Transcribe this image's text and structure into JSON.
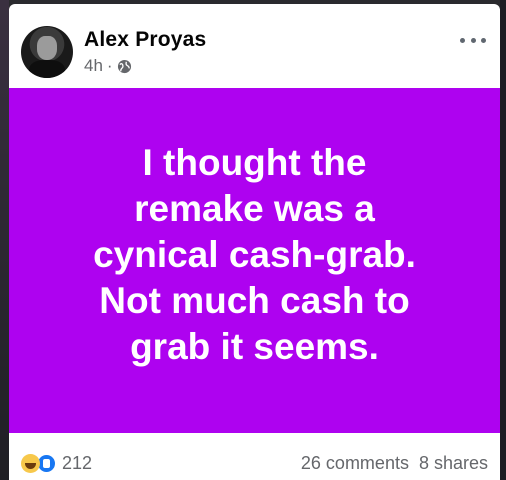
{
  "post": {
    "author_name": "Alex Proyas",
    "timestamp": "4h",
    "separator": "·",
    "audience_icon": "globe-icon",
    "more_icon": "more-options-icon",
    "background_color": "#ae02f0",
    "text_lines": [
      "I thought the",
      "remake was a",
      "cynical cash-grab.",
      "Not much cash to",
      "grab it seems."
    ]
  },
  "footer": {
    "reaction_icons": [
      "haha-reaction-icon",
      "like-reaction-icon"
    ],
    "reaction_count": "212",
    "comments": "26 comments",
    "shares": "8 shares"
  }
}
